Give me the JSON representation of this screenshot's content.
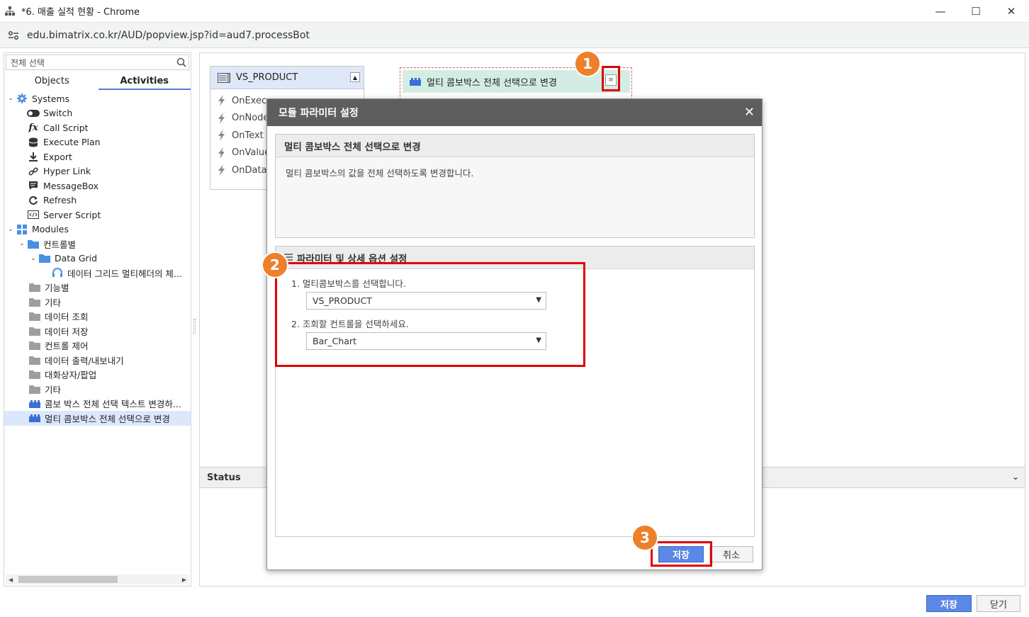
{
  "window": {
    "title": "*6. 매출 실적 현황 - Chrome",
    "url": "edu.bimatrix.co.kr/AUD/popview.jsp?id=aud7.processBot"
  },
  "left_panel": {
    "search_value": "전체 선택",
    "tabs": [
      {
        "label": "Objects"
      },
      {
        "label": "Activities"
      }
    ],
    "tree": [
      {
        "label": "Systems",
        "icon": "gear-icon"
      },
      {
        "label": "Switch",
        "icon": "toggle-icon"
      },
      {
        "label": "Call Script",
        "icon": "fx-icon"
      },
      {
        "label": "Execute Plan",
        "icon": "database-icon"
      },
      {
        "label": "Export",
        "icon": "download-icon"
      },
      {
        "label": "Hyper Link",
        "icon": "link-icon"
      },
      {
        "label": "MessageBox",
        "icon": "message-icon"
      },
      {
        "label": "Refresh",
        "icon": "refresh-icon"
      },
      {
        "label": "Server Script",
        "icon": "code-icon"
      },
      {
        "label": "Modules",
        "icon": "grid-icon"
      },
      {
        "label": "컨트롤별",
        "icon": "folder-icon"
      },
      {
        "label": "Data Grid",
        "icon": "folder-icon"
      },
      {
        "label": "데이터 그리드 멀티헤더의 체...",
        "icon": "headset-icon"
      },
      {
        "label": "기능별",
        "icon": "folder-icon"
      },
      {
        "label": "기타",
        "icon": "folder-icon"
      },
      {
        "label": "데이터 조회",
        "icon": "folder-icon"
      },
      {
        "label": "데이터 저장",
        "icon": "folder-icon"
      },
      {
        "label": "컨트롤 제어",
        "icon": "folder-icon"
      },
      {
        "label": "데이터 출력/내보내기",
        "icon": "folder-icon"
      },
      {
        "label": "대화상자/팝업",
        "icon": "folder-icon"
      },
      {
        "label": "기타",
        "icon": "folder-icon"
      },
      {
        "label": "콤보 박스 전체 선택 텍스트 변경하...",
        "icon": "module-icon"
      },
      {
        "label": "멀티 콤보박스 전체 선택으로 변경",
        "icon": "module-icon"
      }
    ]
  },
  "canvas": {
    "object_node": {
      "title": "VS_PRODUCT",
      "events": [
        "OnExec",
        "OnNode",
        "OnText",
        "OnValue",
        "OnData"
      ]
    },
    "module_node": {
      "title": "멀티 콤보박스 전체 선택으로 변경"
    },
    "status_label": "Status"
  },
  "dialog": {
    "title": "모듈 파라미터 설정",
    "section1": {
      "title": "멀티 콤보박스 전체 선택으로 변경",
      "description": "멀티 콤보박스의 값을 전체 선택하도록 변경합니다."
    },
    "section2": {
      "title": "파라미터 및 상세 옵션 설정",
      "params": [
        {
          "label": "1. 멀티콤보박스를 선택합니다.",
          "value": "VS_PRODUCT"
        },
        {
          "label": "2. 조회할 컨트롤을 선택하세요.",
          "value": "Bar_Chart"
        }
      ]
    },
    "save_label": "저장",
    "cancel_label": "취소"
  },
  "footer": {
    "save_label": "저장",
    "close_label": "닫기"
  },
  "badges": [
    "1",
    "2",
    "3"
  ],
  "colors": {
    "accent": "#5b87e6",
    "highlight": "#e00000",
    "badge": "#ee7f2b"
  }
}
